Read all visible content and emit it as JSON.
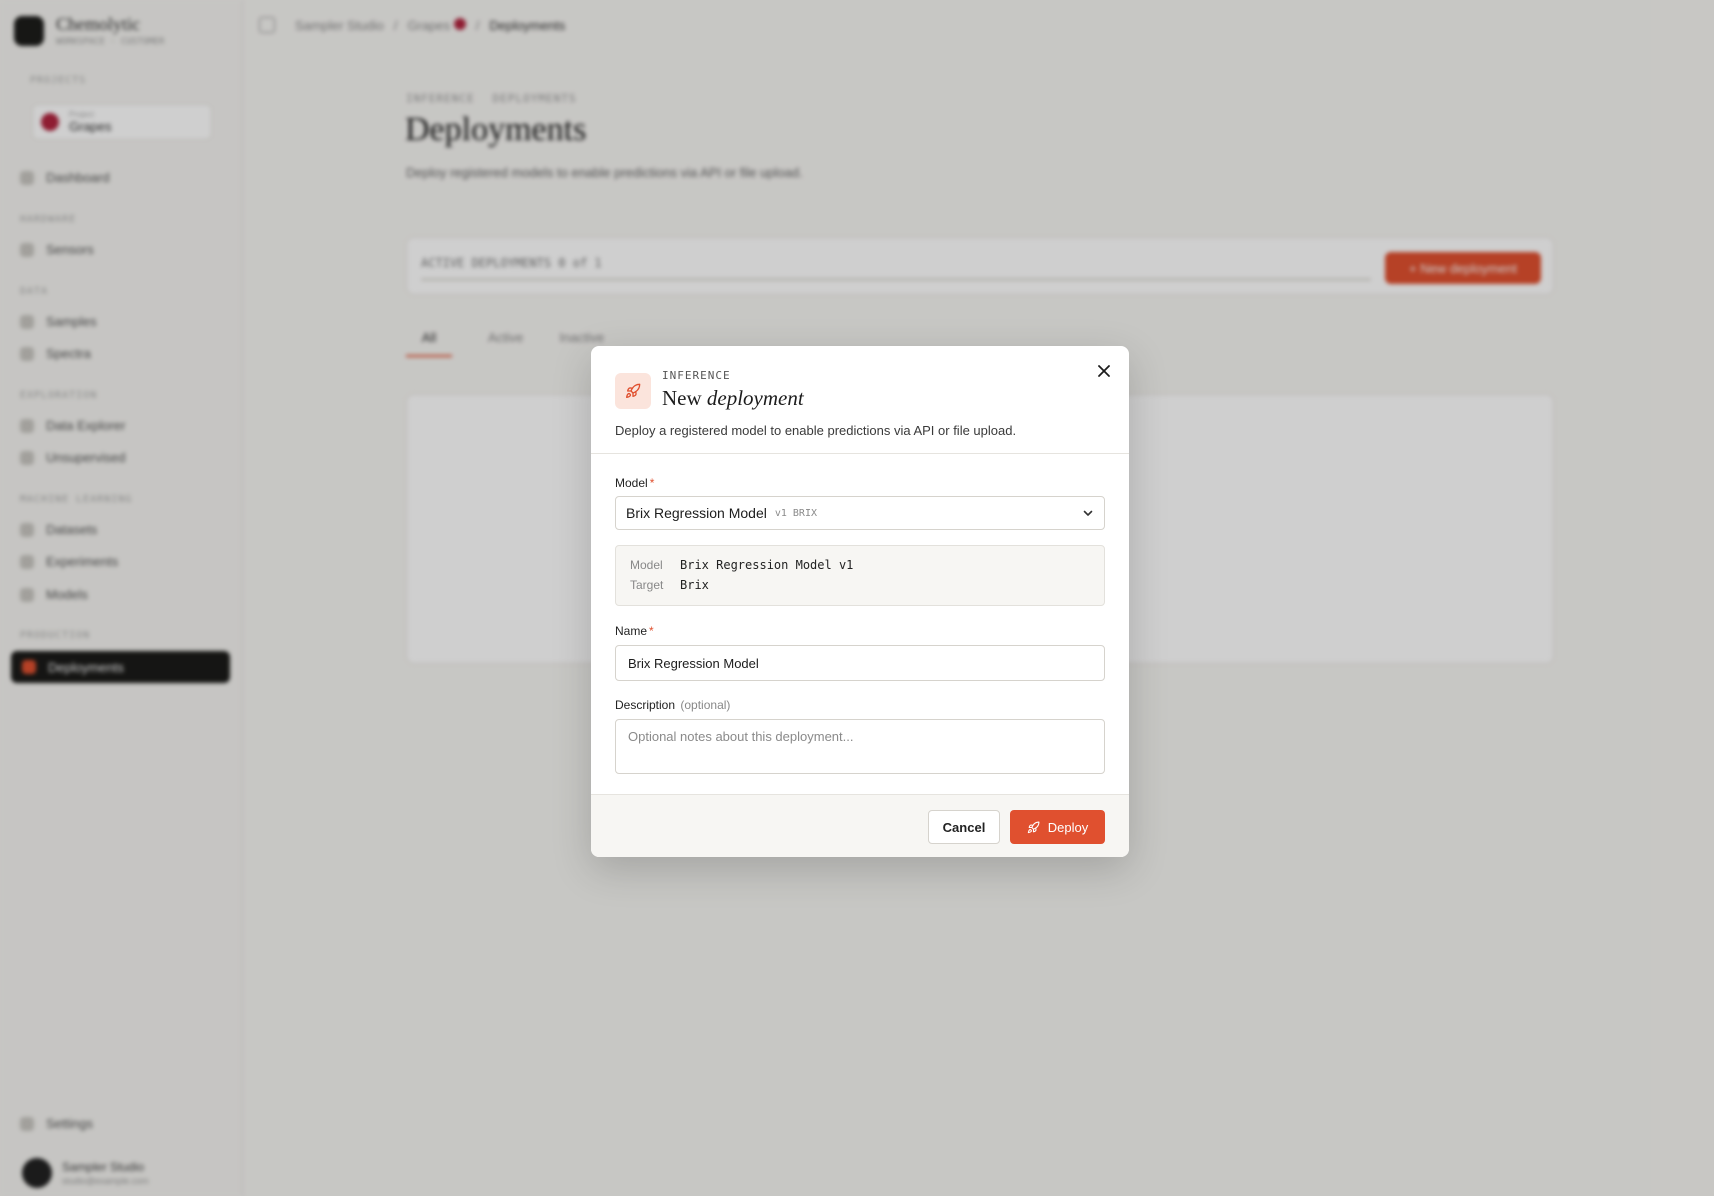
{
  "sidebar": {
    "brand_name": "Chemolytic",
    "brand_sub": "WORKSPACE · CUSTOMER",
    "projects_label": "PROJECTS",
    "project": {
      "meta": "Project",
      "name": "Grapes"
    },
    "dashboard": "Dashboard",
    "section_hardware": "HARDWARE",
    "sensors": "Sensors",
    "section_data": "DATA",
    "samples": "Samples",
    "spectra": "Spectra",
    "section_exploration": "EXPLORATION",
    "data_explorer": "Data Explorer",
    "unsupervised": "Unsupervised",
    "section_ml": "MACHINE LEARNING",
    "datasets": "Datasets",
    "experiments": "Experiments",
    "models": "Models",
    "section_production": "PRODUCTION",
    "deployments": "Deployments",
    "settings": "Settings",
    "user_name": "Sampler Studio",
    "user_email": "studio@example.com"
  },
  "topbar": {
    "crumb_1": "Sampler Studio",
    "crumb_2": "Grapes",
    "crumb_3": "Deployments"
  },
  "page": {
    "eyebrow_1": "INFERENCE",
    "eyebrow_2": "DEPLOYMENTS",
    "title": "Deployments",
    "description": "Deploy registered models to enable predictions via API or file upload.",
    "stat_text": "ACTIVE DEPLOYMENTS 0 of 1",
    "new_button": "+ New deployment",
    "tab_all": "All",
    "tab_active": "Active",
    "tab_inactive": "Inactive"
  },
  "modal": {
    "eyebrow": "INFERENCE",
    "title_plain": "New",
    "title_italic": "deployment",
    "description": "Deploy a registered model to enable predictions via API or file upload.",
    "model_label": "Model",
    "required_mark": "*",
    "model_select": {
      "name": "Brix Regression Model",
      "tag": "v1 BRIX"
    },
    "info": {
      "model_key": "Model",
      "model_value": "Brix Regression Model v1",
      "target_key": "Target",
      "target_value": "Brix"
    },
    "name_label": "Name",
    "name_value": "Brix Regression Model",
    "description_label": "Description",
    "optional_note": "(optional)",
    "description_placeholder": "Optional notes about this deployment...",
    "cancel_label": "Cancel",
    "deploy_label": "Deploy"
  },
  "colors": {
    "accent": "#e0502f",
    "accent_tint": "#fbe4dc",
    "overlay": "rgba(0,0,0,0.19)"
  },
  "icons": {
    "modal_icon": "rocket-icon",
    "close": "close-icon",
    "chevron": "chevron-down-icon",
    "deploy": "rocket-icon"
  }
}
